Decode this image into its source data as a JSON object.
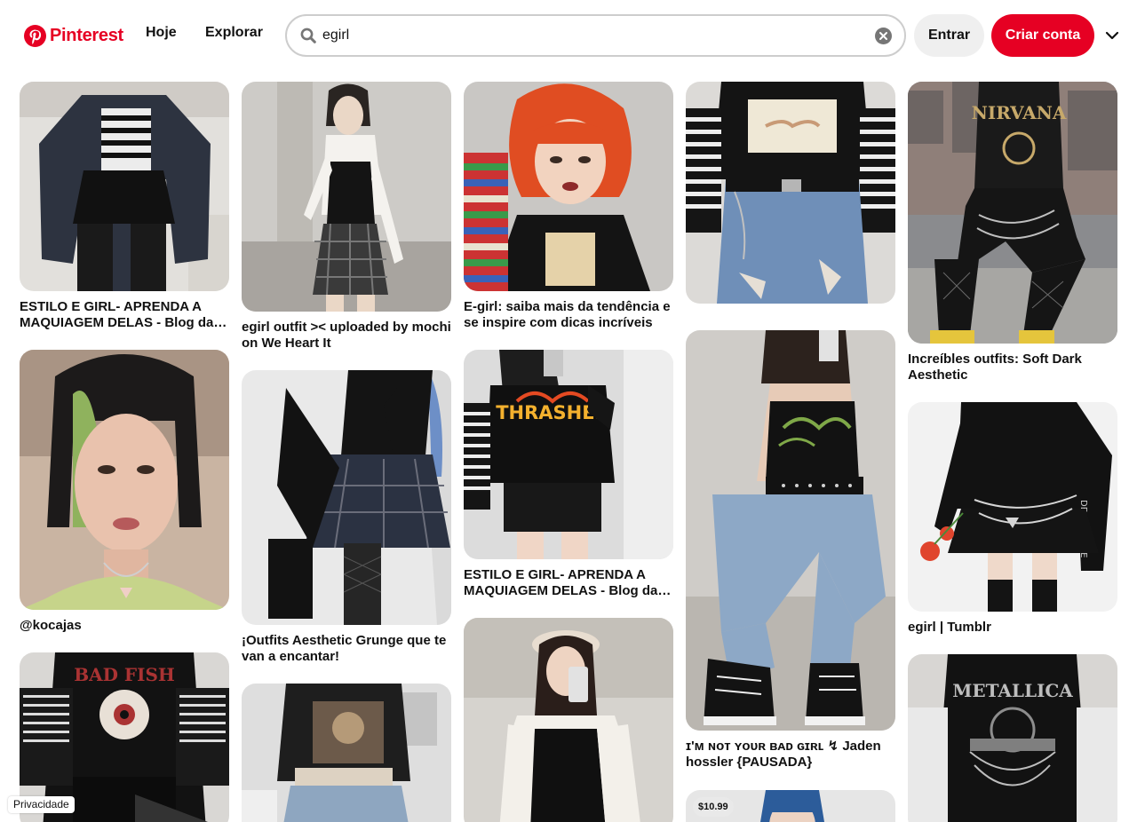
{
  "brand": {
    "name": "Pinterest",
    "color": "#e60023"
  },
  "nav": {
    "today": "Hoje",
    "explore": "Explorar"
  },
  "search": {
    "value": "egirl",
    "icon": "search-icon",
    "clear_icon": "clear-icon"
  },
  "auth": {
    "login": "Entrar",
    "signup": "Criar conta"
  },
  "menu_icon": "chevron-down-icon",
  "pins": [
    {
      "title": "ESTILO E GIRL- APRENDA A MAQUIAGEM DELAS - Blog da Mari Pereira"
    },
    {
      "title": "@kocajas"
    },
    {
      "title": ""
    },
    {
      "title": "egirl outfit >< uploaded by mochi on We Heart It"
    },
    {
      "title": "¡Outfits Aesthetic Grunge que te van a encantar!"
    },
    {
      "title": ""
    },
    {
      "title": "E-girl: saiba mais da tendência e se inspire com dicas incríveis"
    },
    {
      "title": "ESTILO E GIRL- APRENDA A MAQUIAGEM DELAS - Blog da Mari Pereira"
    },
    {
      "title": ""
    },
    {
      "title": ""
    },
    {
      "title": "ɪ'ᴍ ɴᴏᴛ ʏᴏᴜʀ ʙᴀᴅ ɢɪʀʟ ↯ Jaden hossler {PAUSADA}"
    },
    {
      "title": "",
      "price": "$10.99"
    },
    {
      "title": "Increíbles outfits: Soft Dark Aesthetic"
    },
    {
      "title": "egirl | Tumblr"
    },
    {
      "title": ""
    }
  ],
  "footer": {
    "privacy": "Privacidade"
  }
}
